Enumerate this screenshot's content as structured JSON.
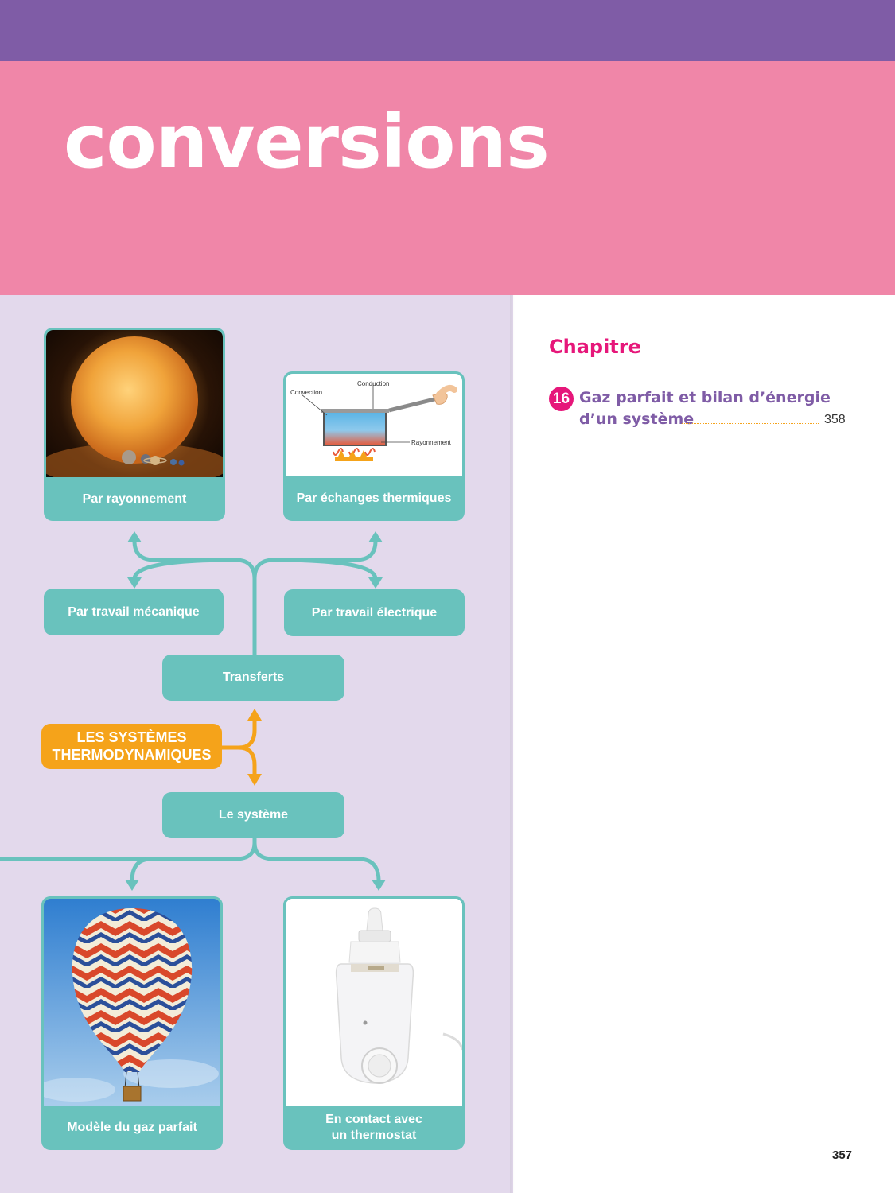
{
  "header": {
    "title": "conversions"
  },
  "mindmap": {
    "center": {
      "line1": "LES SYSTÈMES",
      "line2": "THERMODYNAMIQUES"
    },
    "transferts": "Transferts",
    "systeme": "Le système",
    "travail_mecanique": "Par travail mécanique",
    "travail_electrique": "Par travail électrique",
    "rayonnement": "Par rayonnement",
    "echanges": "Par échanges thermiques",
    "gaz_parfait": "Modèle du gaz parfait",
    "thermostat": {
      "line1": "En contact avec",
      "line2": "un thermostat"
    },
    "diagram_labels": {
      "conduction": "Conduction",
      "convection": "Convection",
      "rayonnement": "Rayonnement"
    }
  },
  "chapters": {
    "heading": "Chapitre",
    "items": [
      {
        "number": "16",
        "title_line1": "Gaz parfait et bilan d’énergie",
        "title_line2": "d’un système",
        "page": "358"
      }
    ]
  },
  "page_number": "357",
  "colors": {
    "purple": "#7f5ca6",
    "pink": "#f086a8",
    "teal": "#69c2bd",
    "orange": "#f5a31a",
    "magenta": "#e6177a",
    "lavender": "#e3d9ec"
  }
}
